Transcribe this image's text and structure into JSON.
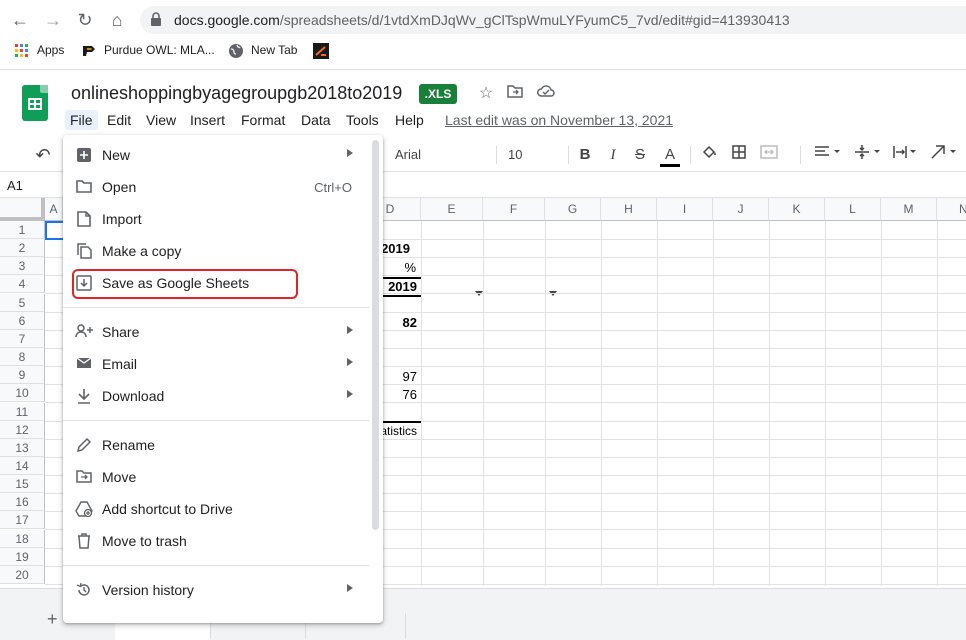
{
  "browser": {
    "url_host": "docs.google.com",
    "url_path": "/spreadsheets/d/1vtdXmDJqWv_gClTspWmuLYFyumC5_7vd/edit#gid=413930413",
    "bookmarks": [
      {
        "label": "Apps",
        "icon": "apps-grid-icon"
      },
      {
        "label": "Purdue OWL: MLA...",
        "icon": "purdue-icon"
      },
      {
        "label": "New Tab",
        "icon": "globe-icon"
      },
      {
        "label": "",
        "icon": "bookmark-favicon"
      }
    ]
  },
  "doc": {
    "title": "onlineshoppingbyagegroupgb2018to2019",
    "badge": ".XLS",
    "last_edit": "Last edit was on November 13, 2021"
  },
  "menubar": [
    "File",
    "Edit",
    "View",
    "Insert",
    "Format",
    "Data",
    "Tools",
    "Help"
  ],
  "toolbar": {
    "font": "Arial",
    "font_size": "10"
  },
  "namebox": "A1",
  "grid": {
    "columns": [
      "A",
      "D",
      "E",
      "F",
      "G",
      "H",
      "I",
      "J",
      "K",
      "L",
      "M",
      "N"
    ],
    "rows": [
      "1",
      "2",
      "3",
      "4",
      "5",
      "6",
      "7",
      "8",
      "9",
      "10",
      "11",
      "12",
      "13",
      "14",
      "15",
      "16",
      "17",
      "18",
      "19",
      "20"
    ],
    "cells": {
      "d2": "2019",
      "d3": "%",
      "d4": "2019",
      "d6": "82",
      "d9": "97",
      "d10": "76",
      "d12": "atistics"
    }
  },
  "file_menu": {
    "items": [
      {
        "label": "New",
        "icon": "new-icon",
        "submenu": true,
        "shortcut": ""
      },
      {
        "label": "Open",
        "icon": "folder-icon",
        "submenu": false,
        "shortcut": "Ctrl+O"
      },
      {
        "label": "Import",
        "icon": "file-import-icon",
        "submenu": false,
        "shortcut": ""
      },
      {
        "label": "Make a copy",
        "icon": "copy-icon",
        "submenu": false,
        "shortcut": ""
      },
      {
        "label": "Save as Google Sheets",
        "icon": "save-download-icon",
        "submenu": false,
        "shortcut": ""
      },
      {
        "label": "Share",
        "icon": "share-person-icon",
        "submenu": true,
        "shortcut": ""
      },
      {
        "label": "Email",
        "icon": "email-icon",
        "submenu": true,
        "shortcut": ""
      },
      {
        "label": "Download",
        "icon": "download-icon",
        "submenu": true,
        "shortcut": ""
      },
      {
        "label": "Rename",
        "icon": "rename-icon",
        "submenu": false,
        "shortcut": ""
      },
      {
        "label": "Move",
        "icon": "move-folder-icon",
        "submenu": false,
        "shortcut": ""
      },
      {
        "label": "Add shortcut to Drive",
        "icon": "drive-shortcut-icon",
        "submenu": false,
        "shortcut": ""
      },
      {
        "label": "Move to trash",
        "icon": "trash-icon",
        "submenu": false,
        "shortcut": ""
      },
      {
        "label": "Version history",
        "icon": "history-icon",
        "submenu": true,
        "shortcut": ""
      }
    ]
  },
  "colors": {
    "sheets_green": "#0f9d58",
    "xls_badge": "#188038",
    "highlight_red": "#e0242c"
  }
}
